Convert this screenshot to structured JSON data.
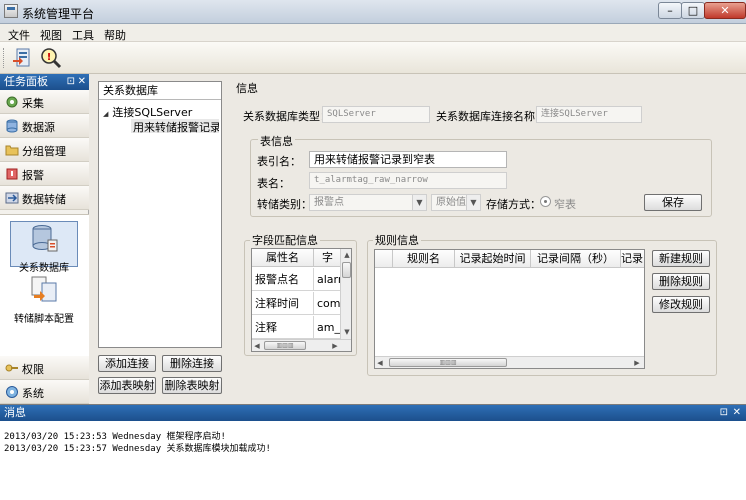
{
  "window": {
    "title": "系统管理平台",
    "min": "–",
    "max": "□",
    "close": "✕"
  },
  "menu": [
    "文件",
    "视图",
    "工具",
    "帮助"
  ],
  "task_panel": {
    "title": "任务面板",
    "pin": "⊡",
    "close": "✕",
    "items": [
      {
        "label": "采集",
        "icon": "gear-icon"
      },
      {
        "label": "数据源",
        "icon": "database-icon"
      },
      {
        "label": "分组管理",
        "icon": "folder-icon"
      },
      {
        "label": "报警",
        "icon": "alarm-icon"
      },
      {
        "label": "数据转储",
        "icon": "transfer-icon"
      }
    ],
    "content_items": [
      "关系数据库",
      "转储脚本配置"
    ],
    "bottom_items": [
      {
        "label": "权限",
        "icon": "key-icon"
      },
      {
        "label": "系统",
        "icon": "system-icon"
      }
    ]
  },
  "tree": {
    "header": "关系数据库",
    "expander": "◢",
    "root": "连接SQLServer",
    "child": "用来转储报警记录..."
  },
  "tree_buttons": [
    "添加连接",
    "删除连接",
    "添加表映射",
    "删除表映射"
  ],
  "info": {
    "title": "信息",
    "db_type_label": "关系数据库类型：",
    "db_type_value": "SQLServer",
    "conn_name_label": "关系数据库连接名称：",
    "conn_name_value": "连接SQLServer"
  },
  "table_info": {
    "title": "表信息",
    "table_name_label": "表引名：",
    "table_name_value": "用来转储报警记录到窄表",
    "name_label": "表名：",
    "name_value": "t_alarmtag_raw_narrow",
    "dump_type_label": "转储类别：",
    "dump_type_value": "报警点",
    "dump_sub_value": "原始值",
    "storage_label": "存储方式：",
    "storage_value": "窄表",
    "save_button": "保存"
  },
  "field_match": {
    "title": "字段匹配信息",
    "headers": [
      "属性名",
      "字"
    ],
    "rows": [
      [
        "报警点名",
        "alarm"
      ],
      [
        "注释时间",
        "com"
      ],
      [
        "注释",
        "am_c"
      ]
    ]
  },
  "rule_info": {
    "title": "规则信息",
    "headers": [
      "规则名",
      "记录起始时间",
      "记录间隔（秒）",
      "记录"
    ],
    "buttons": [
      "新建规则",
      "删除规则",
      "修改规则"
    ]
  },
  "scroll": {
    "up": "▲",
    "down": "▼",
    "left": "◀",
    "right": "▶",
    "grip": "▥▥▥"
  },
  "messages": {
    "title": "消息",
    "pin": "⊡",
    "close": "✕",
    "lines": [
      "2013/03/20 15:23:53 Wednesday 框架程序启动!",
      "2013/03/20 15:23:57 Wednesday 关系数据库模块加载成功!"
    ]
  }
}
